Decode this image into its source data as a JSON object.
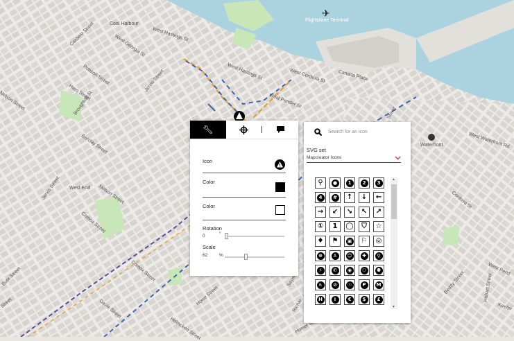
{
  "map": {
    "labels": {
      "coal_harbour": "Coal Harbour",
      "flightplane_terminal": "Flightplane Terminal",
      "west_hastings_1": "West Hastings St",
      "west_georgia": "West Georgia St",
      "cardero": "Cardero Street",
      "robson": "Robson Street",
      "haro": "Haro Street",
      "nelson_1": "Nelson Street",
      "broughton": "Broughton St",
      "barclay": "Barclay Street",
      "jervis_1": "Jervis Street",
      "west_hastings_2": "West Hastings St",
      "west_cordova": "West Cordova St",
      "canada_place": "Canada Place",
      "west_pender": "West Pender St",
      "jervis_2": "Jervis Street",
      "west_end": "West End",
      "nelson_2": "Nelson Street",
      "comox_1": "Comox Street",
      "comox_2": "Comox Street",
      "bute": "Bute Street",
      "davie": "Davie Street",
      "howe": "Howe Street",
      "helmcken": "Helmcken Street",
      "street_edge": "Street",
      "waterfront": "Waterfront",
      "west_waterfront": "West Waterfront Rd",
      "cordova_edge": "Cordova St",
      "west_pend_edge": "West Pend",
      "beatty": "Beatty Street",
      "hobart": "Hobart Street",
      "keefer": "Keefer",
      "seymour": "Seymour",
      "richards": "Richar",
      "homer": "Homer St",
      "street_top": "Street"
    },
    "colors": {
      "water": "#aad3df",
      "park": "#c8e6b8",
      "block": "#d9d6d1",
      "route_blue": "#3d64b4",
      "route_orange": "#e8a13a",
      "route_purple": "#5b4aa0"
    }
  },
  "props_panel": {
    "tabs": [
      {
        "name": "style",
        "icon": "wrench-icon",
        "active": true
      },
      {
        "name": "position",
        "icon": "crosshair-icon",
        "active": false
      },
      {
        "name": "label",
        "icon": "speech-bubble-icon",
        "active": false
      }
    ],
    "icon_label": "Icon",
    "color1_label": "Color",
    "color1_value": "#000000",
    "color2_label": "Color",
    "color2_value": "#ffffff",
    "rotation_label": "Rotation",
    "rotation_value": "0",
    "rotation_unit": "°",
    "rotation_fraction": 0,
    "scale_label": "Scale",
    "scale_value": "62",
    "scale_unit": "%",
    "scale_fraction": 0.35
  },
  "icon_picker": {
    "search_placeholder": "Search for an icon",
    "set_label": "SVG set",
    "set_value": "Mapcreator Icons",
    "icons": [
      "pin-icon",
      "filled-circle-icon",
      "number-1-icon",
      "number-2-icon",
      "number-3-icon",
      "number-4-icon",
      "hash-icon",
      "arrow-up-icon",
      "arrow-down-icon",
      "arrow-left-icon",
      "arrow-right-icon",
      "arrow-down-left-icon",
      "arrow-down-right-icon",
      "arrow-up-left-icon",
      "arrow-up-right-icon",
      "number-1-outline-icon",
      "number-1-square-icon",
      "pin-outline-icon",
      "shield-outline-icon",
      "star-outline-icon",
      "pushpin-icon",
      "flag-icon",
      "flag-square-icon",
      "pennant-icon",
      "target-icon",
      "compass-icon",
      "anchor-icon",
      "person-circle-icon",
      "cross-icon",
      "walking-icon",
      "running-icon",
      "phone-icon",
      "cyclist-icon",
      "couple-icon",
      "people-icon",
      "wheelchair-icon",
      "no-smoking-icon",
      "smoking-icon",
      "parking-icon",
      "metro-icon",
      "hotel-icon",
      "info-icon",
      "euro-icon",
      "dollar-icon",
      "pound-icon"
    ],
    "icon_glyphs": [
      "⚲",
      "●",
      "1",
      "2",
      "3",
      "4",
      "#",
      "↑",
      "↓",
      "←",
      "→",
      "↙",
      "↘",
      "↖",
      "↗",
      "①",
      "1",
      "◯",
      "⛉",
      "☆",
      "♦",
      "⚑",
      "▣",
      "⚐",
      "◎",
      "⊕",
      "⚓",
      "☺",
      "✚",
      "⚲",
      "⚡",
      "✆",
      "◉",
      "⚇",
      "⚉",
      "♿",
      "⊘",
      "☉",
      "P",
      "M",
      "H",
      "i",
      "€",
      "$",
      "£"
    ]
  }
}
